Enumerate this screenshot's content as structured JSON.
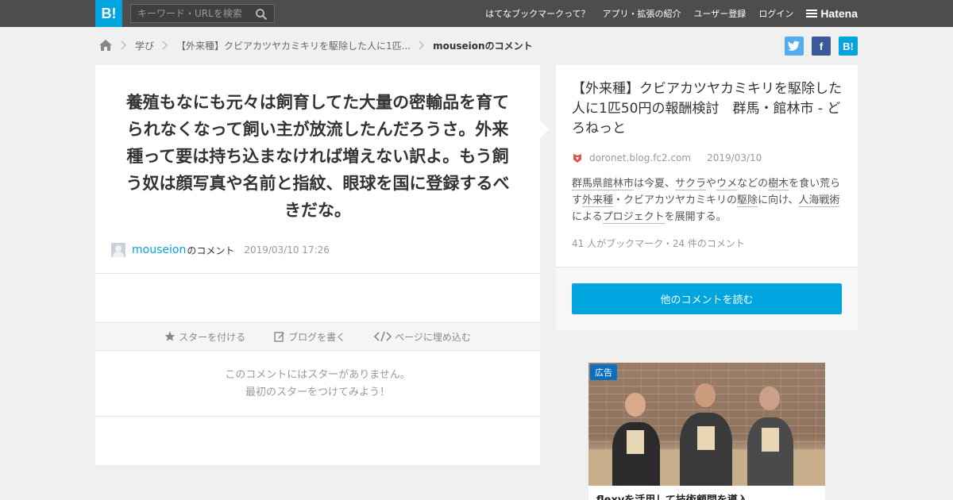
{
  "header": {
    "logo": "B!",
    "search_placeholder": "キーワード・URLを検索",
    "nav": [
      "はてなブックマークって？",
      "アプリ・拡張の紹介",
      "ユーザー登録",
      "ログイン"
    ],
    "brand": "Hatena"
  },
  "breadcrumb": {
    "items": [
      "学び",
      "【外来種】クビアカツヤカミキリを駆除した人に1匹..."
    ],
    "current": "mouseionのコメント"
  },
  "share": {
    "facebook": "f",
    "hatena": "B!"
  },
  "comment": {
    "text": "養殖もなにも元々は飼育してた大量の密輸品を育てられなくなって飼い主が放流したんだろうさ。外来種って要は持ち込まなければ増えない訳よ。もう飼う奴は顔写真や名前と指紋、眼球を国に登録するべきだな。",
    "user": "mouseion",
    "user_suffix": "のコメント",
    "date": "2019/03/10 17:26",
    "actions": [
      "スターを付ける",
      "ブログを書く",
      "ページに埋め込む"
    ],
    "no_star_line1": "このコメントにはスターがありません。",
    "no_star_line2": "最初のスターをつけてみよう！"
  },
  "entry": {
    "title": "【外来種】クビアカツヤカミキリを駆除した人に1匹50円の報酬検討　群馬・館林市 - どろねっと",
    "domain": "doronet.blog.fc2.com",
    "date": "2019/03/10",
    "desc_parts": [
      "群馬県館林市",
      "は今夏、",
      "サクラ",
      "や",
      "ウメ",
      "などの",
      "樹木",
      "を食い荒らす",
      "外来種",
      "・クビアカツヤカミキリの",
      "駆除",
      "に向け、",
      "人海戦術",
      "による",
      "プロジェクト",
      "を展開する。"
    ],
    "counts": "41 人がブックマーク・24 件のコメント",
    "read_button": "他のコメントを読む"
  },
  "ad": {
    "badge": "広告",
    "title": "flexyを活用して技術顧問を導入"
  },
  "colors": {
    "accent": "#00a4de",
    "header_bg": "#4d4d4d",
    "page_bg": "#f0f0f0"
  }
}
